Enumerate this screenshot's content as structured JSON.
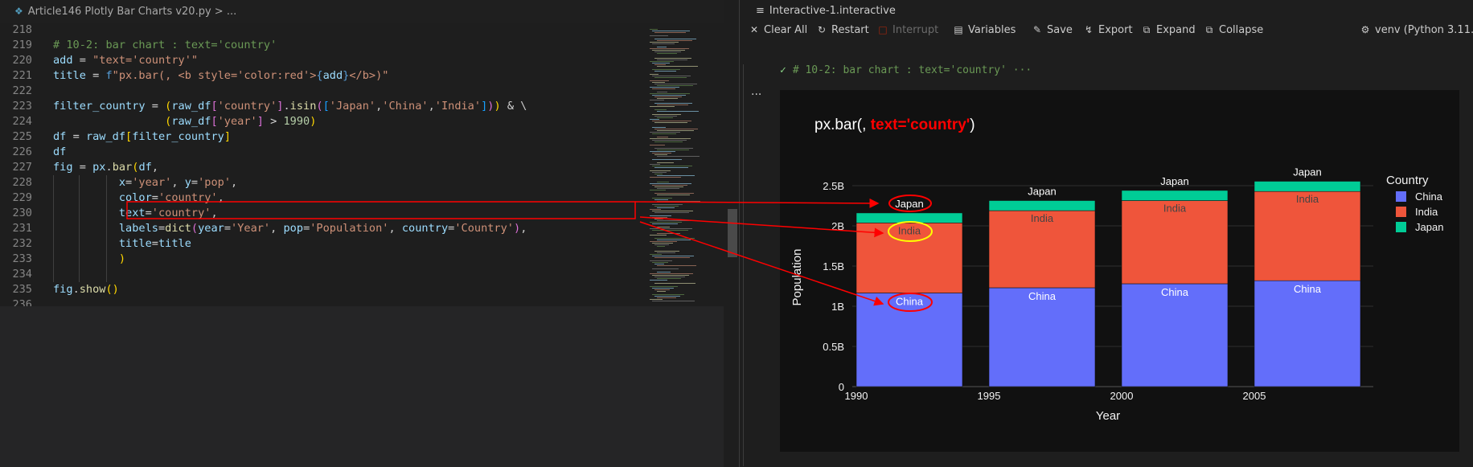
{
  "editor": {
    "breadcrumb": "Article146 Plotly Bar Charts v20.py > ...",
    "lines": [
      {
        "n": "218",
        "html": ""
      },
      {
        "n": "219",
        "html": "<span class='c-com'># 10-2: bar chart : text='country'</span>"
      },
      {
        "n": "220",
        "html": "<span class='c-var'>add</span> <span class='c-op'>=</span> <span class='c-str'>\"text='country'\"</span>"
      },
      {
        "n": "221",
        "html": "<span class='c-var'>title</span> <span class='c-op'>=</span> <span class='c-kw'>f</span><span class='c-str'>\"px.bar(, &lt;b style='color:red'&gt;</span><span class='c-kw'>{</span><span class='c-var'>add</span><span class='c-kw'>}</span><span class='c-str'>&lt;/b&gt;)\"</span>"
      },
      {
        "n": "222",
        "html": ""
      },
      {
        "n": "223",
        "html": "<span class='c-var'>filter_country</span> <span class='c-op'>=</span> <span class='c-brk'>(</span><span class='c-var'>raw_df</span><span class='c-brk2'>[</span><span class='c-str'>'country'</span><span class='c-brk2'>]</span>.<span class='c-fn'>isin</span><span class='c-brk2'>(</span><span class='c-brk3'>[</span><span class='c-str'>'Japan'</span>,<span class='c-str'>'China'</span>,<span class='c-str'>'India'</span><span class='c-brk3'>]</span><span class='c-brk2'>)</span><span class='c-brk'>)</span> <span class='c-op'>&amp;</span> \\"
      },
      {
        "n": "224",
        "html": "                 <span class='c-brk'>(</span><span class='c-var'>raw_df</span><span class='c-brk2'>[</span><span class='c-str'>'year'</span><span class='c-brk2'>]</span> <span class='c-op'>&gt;</span> <span class='c-num'>1990</span><span class='c-brk'>)</span>"
      },
      {
        "n": "225",
        "html": "<span class='c-var'>df</span> <span class='c-op'>=</span> <span class='c-var'>raw_df</span><span class='c-brk'>[</span><span class='c-var'>filter_country</span><span class='c-brk'>]</span>"
      },
      {
        "n": "226",
        "html": "<span class='c-var'>df</span>"
      },
      {
        "n": "227",
        "html": "<span class='c-var'>fig</span> <span class='c-op'>=</span> <span class='c-var'>px</span>.<span class='c-fn'>bar</span><span class='c-brk'>(</span><span class='c-var'>df</span>,"
      },
      {
        "n": "228",
        "html": "          <span class='c-var'>x</span><span class='c-op'>=</span><span class='c-str'>'year'</span>, <span class='c-var'>y</span><span class='c-op'>=</span><span class='c-str'>'pop'</span>,"
      },
      {
        "n": "229",
        "html": "          <span class='c-var'>color</span><span class='c-op'>=</span><span class='c-str'>'country'</span>,"
      },
      {
        "n": "230",
        "html": "          <span class='c-var'>text</span><span class='c-op'>=</span><span class='c-str'>'country'</span>,"
      },
      {
        "n": "231",
        "html": "          <span class='c-var'>labels</span><span class='c-op'>=</span><span class='c-fn'>dict</span><span class='c-brk2'>(</span><span class='c-var'>year</span><span class='c-op'>=</span><span class='c-str'>'Year'</span>, <span class='c-var'>pop</span><span class='c-op'>=</span><span class='c-str'>'Population'</span>, <span class='c-var'>country</span><span class='c-op'>=</span><span class='c-str'>'Country'</span><span class='c-brk2'>)</span>,"
      },
      {
        "n": "232",
        "html": "          <span class='c-var'>title</span><span class='c-op'>=</span><span class='c-var'>title</span>"
      },
      {
        "n": "233",
        "html": "          <span class='c-brk'>)</span>"
      },
      {
        "n": "234",
        "html": ""
      },
      {
        "n": "235",
        "html": "<span class='c-var'>fig</span>.<span class='c-fn'>show</span><span class='c-brk'>()</span>"
      },
      {
        "n": "236",
        "html": ""
      }
    ]
  },
  "interactive": {
    "title": "Interactive-1.interactive",
    "toolbar": {
      "clear_all": "Clear All",
      "restart": "Restart",
      "interrupt": "Interrupt",
      "variables": "Variables",
      "save": "Save",
      "export": "Export",
      "expand": "Expand",
      "collapse": "Collapse",
      "kernel": "venv (Python 3.11.1)"
    },
    "cell_header": "# 10-2: bar chart : text='country' ···",
    "cell_more": "···"
  },
  "colors": {
    "china": "#636efa",
    "india": "#ef553b",
    "japan": "#00cc96",
    "title_red": "#ff0000",
    "annot_red": "#ff0000",
    "annot_yellow": "#ffff00"
  },
  "chart_data": {
    "type": "bar",
    "barmode": "stack",
    "title_prefix": "px.bar(, ",
    "title_red": "text='country'",
    "title_suffix": ")",
    "xlabel": "Year",
    "ylabel": "Population",
    "categories": [
      "1992",
      "1997",
      "2002",
      "2007"
    ],
    "x_ticks": [
      "1990",
      "1995",
      "2000",
      "2005"
    ],
    "y_ticks": [
      "0",
      "0.5B",
      "1B",
      "1.5B",
      "2B",
      "2.5B"
    ],
    "ylim": [
      0,
      2.6
    ],
    "series": [
      {
        "name": "China",
        "values": [
          1.165,
          1.23,
          1.28,
          1.318
        ],
        "label": "China"
      },
      {
        "name": "India",
        "values": [
          0.872,
          0.959,
          1.034,
          1.11
        ],
        "label": "India"
      },
      {
        "name": "Japan",
        "values": [
          0.124,
          0.126,
          0.127,
          0.127
        ],
        "label": "Japan"
      }
    ],
    "legend_title": "Country",
    "legend_position": "top-right"
  }
}
